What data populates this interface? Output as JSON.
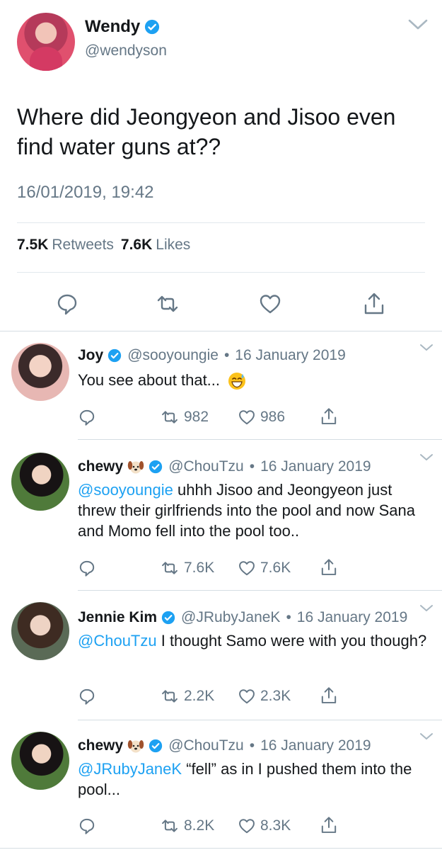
{
  "main_tweet": {
    "author_name": "Wendy",
    "author_handle": "@wendyson",
    "text": "Where did Jeongyeon and Jisoo even find water guns at??",
    "timestamp": "16/01/2019, 19:42",
    "retweets_count": "7.5K",
    "retweets_label": "Retweets",
    "likes_count": "7.6K",
    "likes_label": "Likes"
  },
  "replies": [
    {
      "name": "Joy",
      "handle": "@sooyoungie",
      "separator": "•",
      "date": "16 January 2019",
      "mention": "",
      "text": "You see about that...",
      "retweets": "982",
      "likes": "986",
      "emoji": "sweat-smile-emoji"
    },
    {
      "name": "chewy",
      "handle": "@ChouTzu",
      "separator": "•",
      "date": "16 January 2019",
      "mention": "@sooyoungie",
      "text": " uhhh Jisoo and Jeongyeon just threw their girlfriends into the pool and now Sana and Momo fell into the pool too..",
      "retweets": "7.6K",
      "likes": "7.6K",
      "emoji": "dog-face-emoji"
    },
    {
      "name": "Jennie Kim",
      "handle": "@JRubyJaneK",
      "separator": "•",
      "date": "16 January 2019",
      "mention": "@ChouTzu",
      "text": " I thought Samo were with you though?",
      "retweets": "2.2K",
      "likes": "2.3K",
      "emoji": ""
    },
    {
      "name": "chewy",
      "handle": "@ChouTzu",
      "separator": "•",
      "date": "16 January 2019",
      "mention": "@JRubyJaneK",
      "text": " “fell” as in I pushed them into the pool...",
      "retweets": "8.2K",
      "likes": "8.3K",
      "emoji": "dog-face-emoji"
    }
  ],
  "colors": {
    "link": "#1da1f2",
    "secondary_text": "#657786",
    "verified": "#1da1f2",
    "divider": "#e1e8ed"
  },
  "icons": [
    "verified-badge-icon",
    "chevron-down-icon",
    "reply-icon",
    "retweet-icon",
    "like-icon",
    "share-icon"
  ]
}
